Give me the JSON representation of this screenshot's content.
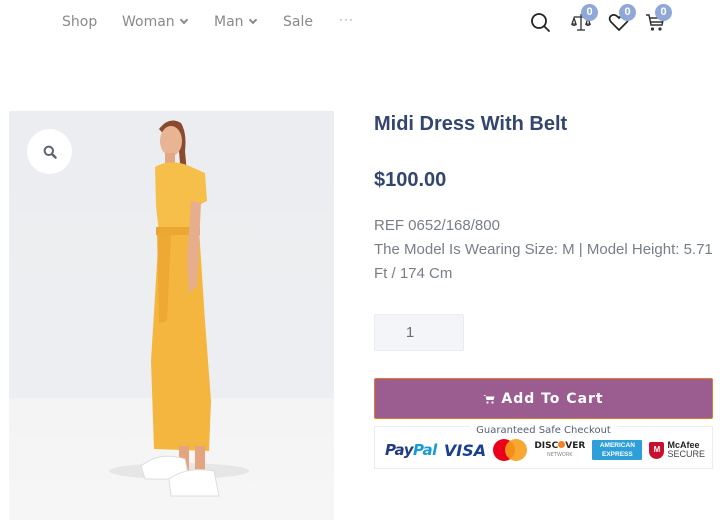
{
  "nav": {
    "items": [
      {
        "label": "Shop",
        "has_dropdown": false
      },
      {
        "label": "Woman",
        "has_dropdown": true
      },
      {
        "label": "Man",
        "has_dropdown": true
      },
      {
        "label": "Sale",
        "has_dropdown": false
      }
    ],
    "more_label": "···"
  },
  "header_icons": {
    "search": {
      "icon": "search-icon"
    },
    "compare": {
      "icon": "scale-icon",
      "count": "0"
    },
    "wishlist": {
      "icon": "heart-icon",
      "count": "0"
    },
    "cart": {
      "icon": "cart-icon",
      "count": "0"
    }
  },
  "product": {
    "image_alt": "Model wearing yellow midi dress with belt",
    "zoom_icon": "search-icon",
    "title": "Midi Dress With Belt",
    "price": "$100.00",
    "ref": "REF 0652/168/800",
    "model_info": "The Model Is Wearing Size: M | Model Height: 5.71 Ft / 174 Cm",
    "quantity": "1",
    "add_to_cart_label": "Add To Cart",
    "accent_color": "#9b5c8f"
  },
  "safe_checkout": {
    "label": "Guaranteed Safe Checkout",
    "logos": {
      "paypal_a": "Pay",
      "paypal_b": "Pal",
      "visa": "VISA",
      "mastercard": "MasterCard",
      "discover_a": "DISC",
      "discover_b": "VER",
      "discover_sub": "NETWORK",
      "amex_a": "AMERICAN",
      "amex_b": "EXPRESS",
      "mcafee_a": "McAfee",
      "mcafee_b": "SECURE",
      "mcafee_shield": "M"
    }
  }
}
